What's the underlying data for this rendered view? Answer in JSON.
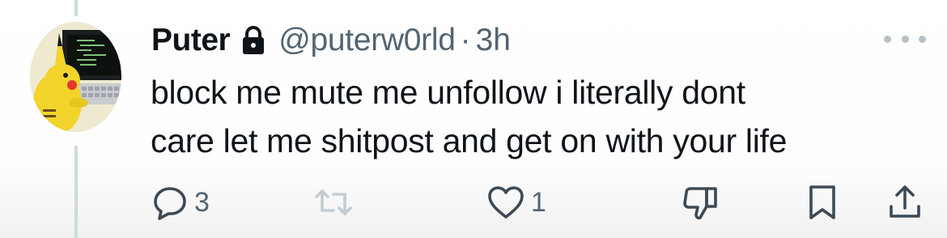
{
  "tweet": {
    "author_name": "Puter",
    "handle": "@puterw0rld",
    "separator": "·",
    "time": "3h",
    "text_lines": [
      "block me mute me unfollow i literally dont",
      "care let me shitpost and get on with your life"
    ]
  },
  "actions": {
    "replies": "3",
    "likes": "1"
  },
  "icons": {
    "lock": "lock-icon",
    "more": "more-dots-icon",
    "reply": "speech-bubble-icon",
    "retweet": "retweet-arrows-icon",
    "like": "heart-icon",
    "dislike": "thumbs-down-icon",
    "bookmark": "bookmark-icon",
    "share": "share-upload-icon"
  },
  "colors": {
    "text": "#0f1419",
    "secondary": "#536471",
    "retweet_disabled": "#c3ccd3",
    "thread_line": "#cfd9de",
    "pikachu_yellow": "#f2d42a"
  }
}
